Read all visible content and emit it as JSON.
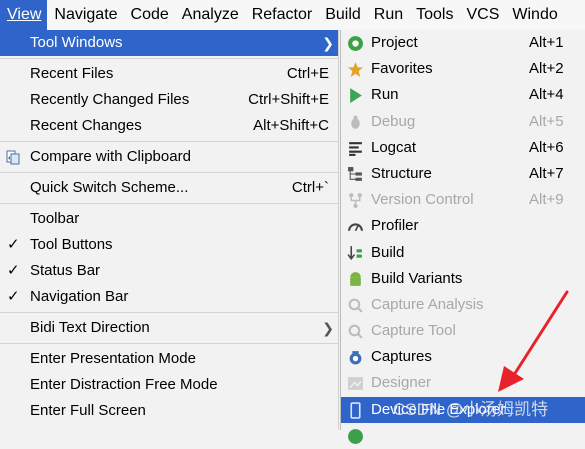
{
  "menubar": {
    "items": [
      "View",
      "Navigate",
      "Code",
      "Analyze",
      "Refactor",
      "Build",
      "Run",
      "Tools",
      "VCS",
      "Windo"
    ]
  },
  "view_menu": {
    "tool_windows": "Tool Windows",
    "recent_files": "Recent Files",
    "recent_files_sc": "Ctrl+E",
    "recently_changed": "Recently Changed Files",
    "recently_changed_sc": "Ctrl+Shift+E",
    "recent_changes": "Recent Changes",
    "recent_changes_sc": "Alt+Shift+C",
    "compare_clipboard": "Compare with Clipboard",
    "quick_switch": "Quick Switch Scheme...",
    "quick_switch_sc": "Ctrl+`",
    "toolbar": "Toolbar",
    "tool_buttons": "Tool Buttons",
    "status_bar": "Status Bar",
    "navigation_bar": "Navigation Bar",
    "bidi": "Bidi Text Direction",
    "presentation": "Enter Presentation Mode",
    "distraction": "Enter Distraction Free Mode",
    "full_screen": "Enter Full Screen"
  },
  "tool_windows_menu": {
    "items": [
      {
        "label": "Project",
        "shortcut": "Alt+1"
      },
      {
        "label": "Favorites",
        "shortcut": "Alt+2"
      },
      {
        "label": "Run",
        "shortcut": "Alt+4"
      },
      {
        "label": "Debug",
        "shortcut": "Alt+5"
      },
      {
        "label": "Logcat",
        "shortcut": "Alt+6"
      },
      {
        "label": "Structure",
        "shortcut": "Alt+7"
      },
      {
        "label": "Version Control",
        "shortcut": "Alt+9"
      },
      {
        "label": "Profiler",
        "shortcut": ""
      },
      {
        "label": "Build",
        "shortcut": ""
      },
      {
        "label": "Build Variants",
        "shortcut": ""
      },
      {
        "label": "Capture Analysis",
        "shortcut": ""
      },
      {
        "label": "Capture Tool",
        "shortcut": ""
      },
      {
        "label": "Captures",
        "shortcut": ""
      },
      {
        "label": "Designer",
        "shortcut": ""
      },
      {
        "label": "Device File Explorer",
        "shortcut": ""
      }
    ]
  },
  "watermark": "CSDN @小汤姆凯特",
  "colors": {
    "highlight": "#2f65ca",
    "arrow": "#e8222a",
    "disabled": "#a8a8a8"
  }
}
